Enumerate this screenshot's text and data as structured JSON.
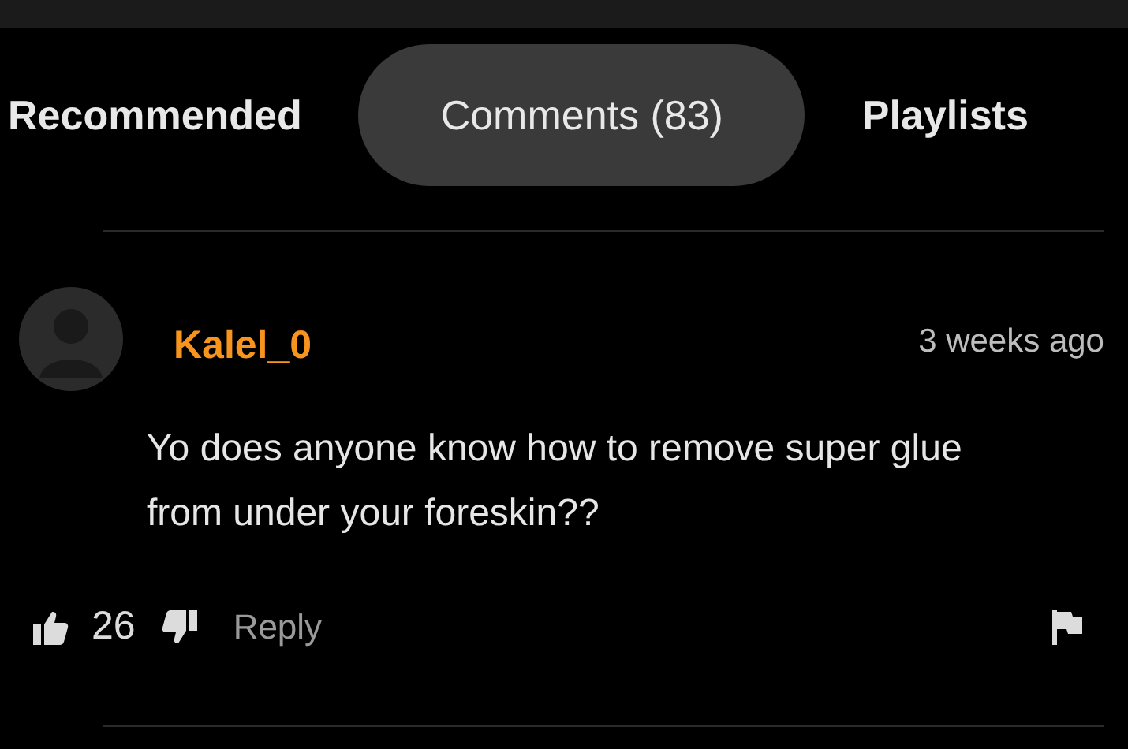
{
  "tabs": [
    {
      "label": "Recommended",
      "selected": false
    },
    {
      "label": "Comments (83)",
      "selected": true
    },
    {
      "label": "Playlists",
      "selected": false
    }
  ],
  "comment": {
    "author": "Kalel_0",
    "time": "3 weeks ago",
    "text": "Yo does anyone know how to remove super glue from under your foreskin??",
    "likes": "26",
    "reply": "Reply"
  }
}
